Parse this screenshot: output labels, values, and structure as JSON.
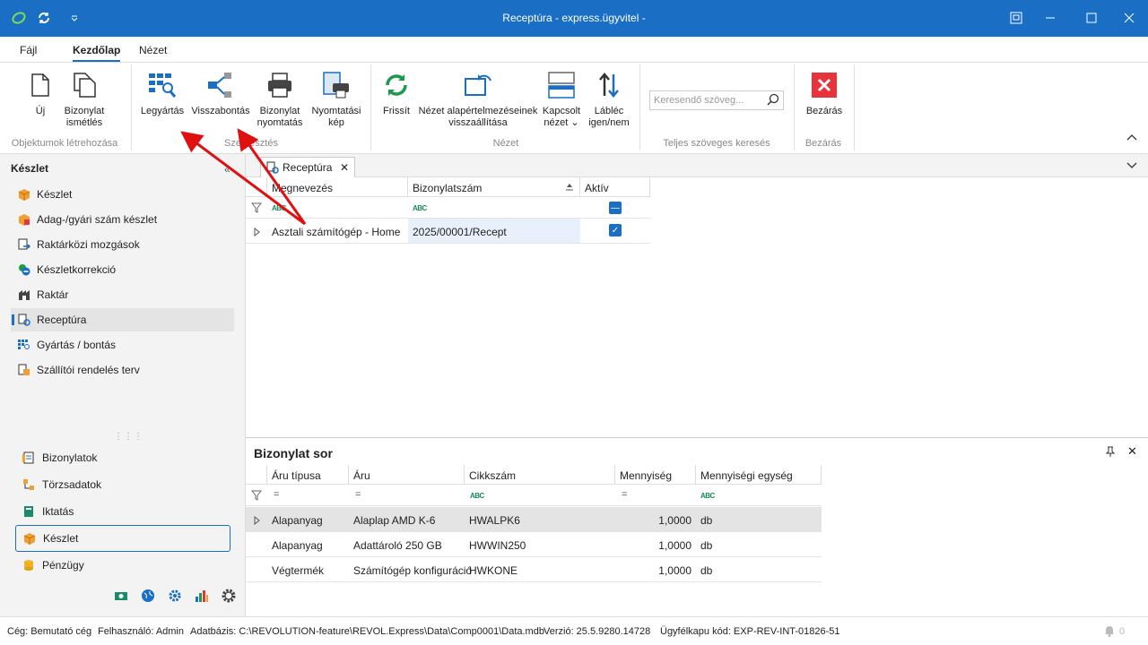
{
  "window": {
    "title": "Receptúra - express.ügyvitel -"
  },
  "menu": {
    "file": "Fájl",
    "home": "Kezdőlap",
    "view": "Nézet"
  },
  "ribbon": {
    "new": "Új",
    "repeat_line1": "Bizonylat",
    "repeat_line2": "ismétlés",
    "group_create": "Objektumok létrehozása",
    "manufacture": "Legyártás",
    "disassemble": "Visszabontás",
    "print_line1": "Bizonylat",
    "print_line2": "nyomtatás",
    "printpic_line1": "Nyomtatási",
    "printpic_line2": "kép",
    "group_edit": "Szerkesztés",
    "refresh": "Frissít",
    "reset_line1": "Nézet alapértelmezéseinek",
    "reset_line2": "visszaállítása",
    "linked_line1": "Kapcsolt",
    "linked_line2": "nézet",
    "footer_line1": "Lábléc",
    "footer_line2": "igen/nem",
    "group_view": "Nézet",
    "search_placeholder": "Keresendő szöveg...",
    "group_search": "Teljes szöveges keresés",
    "close": "Bezárás",
    "group_close": "Bezárás"
  },
  "left": {
    "title": "Készlet",
    "items": [
      {
        "label": "Készlet"
      },
      {
        "label": "Adag-/gyári szám készlet"
      },
      {
        "label": "Raktárközi mozgások"
      },
      {
        "label": "Készletkorrekció"
      },
      {
        "label": "Raktár"
      },
      {
        "label": "Receptúra"
      },
      {
        "label": "Gyártás / bontás"
      },
      {
        "label": "Szállítói rendelés terv"
      }
    ],
    "modules": [
      {
        "label": "Bizonylatok"
      },
      {
        "label": "Törzsadatok"
      },
      {
        "label": "Iktatás"
      },
      {
        "label": "Készlet"
      },
      {
        "label": "Pénzügy"
      }
    ]
  },
  "doc_tab": "Receptúra",
  "grid": {
    "columns": [
      "Megnevezés",
      "Bizonylatszám",
      "Aktív"
    ],
    "row": {
      "name": "Asztali számítógép - Home",
      "number": "2025/00001/Recept"
    }
  },
  "bottom": {
    "title": "Bizonylat sor",
    "columns": [
      "Áru típusa",
      "Áru",
      "Cikkszám",
      "Mennyiség",
      "Mennyiségi egység"
    ],
    "rows": [
      {
        "type": "Alapanyag",
        "item": "Alaplap AMD K-6",
        "sku": "HWALPK6",
        "qty": "1,0000",
        "unit": "db"
      },
      {
        "type": "Alapanyag",
        "item": "Adattároló 250 GB",
        "sku": "HWWIN250",
        "qty": "1,0000",
        "unit": "db"
      },
      {
        "type": "Végtermék",
        "item": "Számítógép konfiguráció",
        "sku": "HWKONE",
        "qty": "1,0000",
        "unit": "db"
      }
    ]
  },
  "status": {
    "company": "Cég: Bemutató cég",
    "user": "Felhasználó: Admin",
    "db": "Adatbázis: C:\\REVOLUTION-feature\\REVOL.Express\\Data\\Comp0001\\Data.mdb",
    "version": "Verzió: 25.5.9280.14728",
    "client": "Ügyfélkapu kód: EXP-REV-INT-01826-51",
    "notif": "0"
  },
  "colors": {
    "accent": "#1a6fc4",
    "arrow": "#e01010",
    "close_red": "#e8333c"
  }
}
